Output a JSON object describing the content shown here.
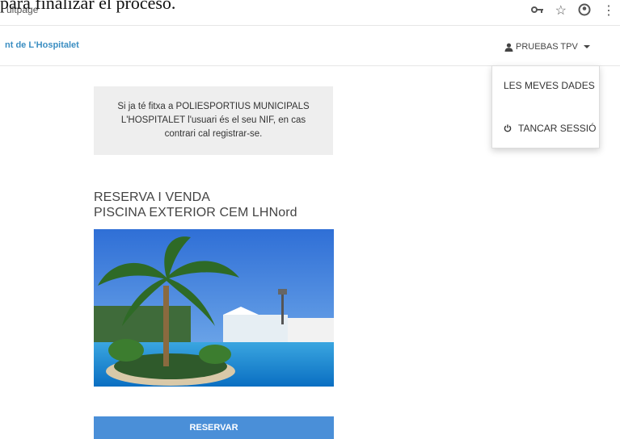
{
  "overlay_caption": "para finalizar el proceso.",
  "browser": {
    "url_fragment": "ultpage",
    "icons": [
      "key-icon",
      "star-icon",
      "profile-icon",
      "more-icon"
    ]
  },
  "navbar": {
    "brand": "nt de L'Hospitalet",
    "user_label": "PRUEBAS TPV",
    "user_icon": "user-icon"
  },
  "dropdown": {
    "items": [
      {
        "label": "LES MEVES DADES"
      },
      {
        "label": "TANCAR SESSIÓ",
        "icon": "power-icon"
      }
    ]
  },
  "notice": {
    "text": "Si ja té fitxa a POLIESPORTIUS MUNICIPALS L'HOSPITALET l'usuari és el seu NIF, en cas contrari cal registrar-se."
  },
  "section": {
    "title_line1": "RESERVA I VENDA",
    "title_line2": "PISCINA EXTERIOR CEM LHNord"
  },
  "photo": {
    "depicts": "piscina-exterior"
  },
  "reserve_button": "RESERVAR",
  "colors": {
    "brand": "#3b8ec2",
    "button": "#4a8fd8",
    "notice_bg": "#eeeeee"
  }
}
